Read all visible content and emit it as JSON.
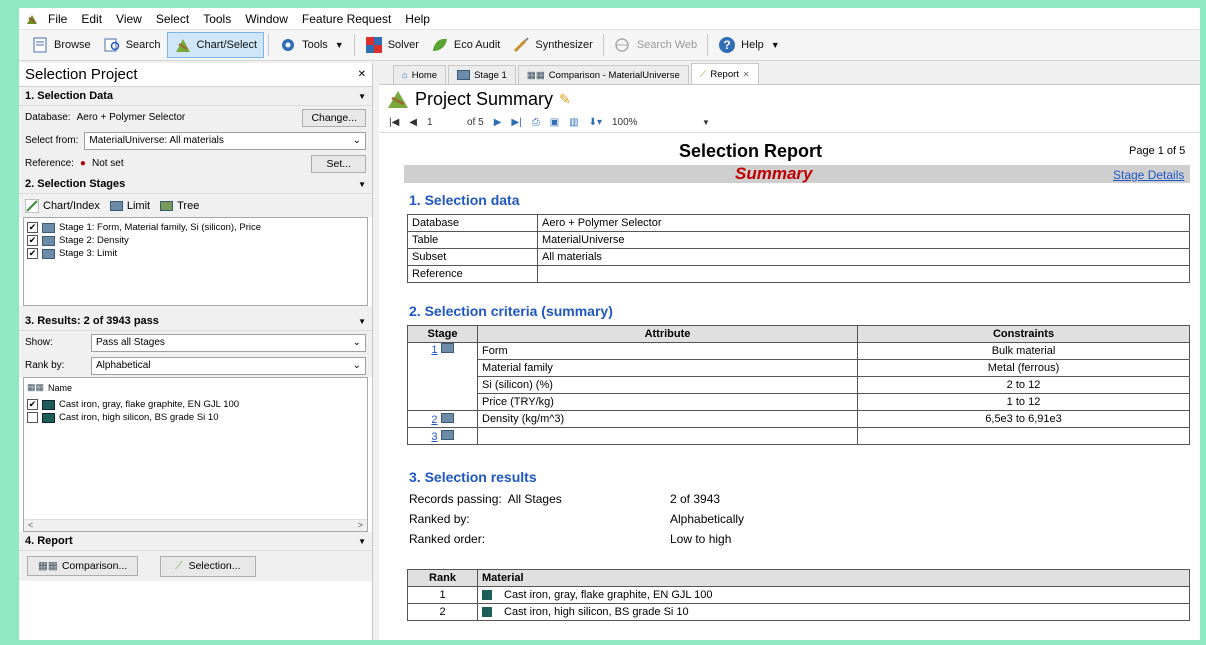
{
  "menu": {
    "items": [
      "File",
      "Edit",
      "View",
      "Select",
      "Tools",
      "Window",
      "Feature Request",
      "Help"
    ]
  },
  "toolbar": {
    "browse": "Browse",
    "search": "Search",
    "chart_select": "Chart/Select",
    "tools": "Tools",
    "solver": "Solver",
    "eco_audit": "Eco Audit",
    "synthesizer": "Synthesizer",
    "search_web": "Search Web",
    "help": "Help"
  },
  "left": {
    "title": "Selection Project",
    "sec1": "1. Selection Data",
    "database_label": "Database:",
    "database_value": "Aero + Polymer Selector",
    "change": "Change...",
    "select_from_label": "Select from:",
    "select_from_value": "MaterialUniverse: All materials",
    "reference_label": "Reference:",
    "reference_value": "Not set",
    "set": "Set...",
    "sec2": "2. Selection Stages",
    "stage_tools": [
      "Chart/Index",
      "Limit",
      "Tree"
    ],
    "stages": [
      "Stage 1: Form, Material family, Si (silicon), Price",
      "Stage 2: Density",
      "Stage 3: Limit"
    ],
    "sec3": "3. Results: 2 of 3943 pass",
    "show_label": "Show:",
    "show_value": "Pass all Stages",
    "rank_label": "Rank by:",
    "rank_value": "Alphabetical",
    "name_header": "Name",
    "results": [
      "Cast iron, gray, flake graphite, EN GJL 100",
      "Cast iron, high silicon, BS grade Si 10"
    ],
    "sec4": "4. Report",
    "comparison": "Comparison...",
    "selection": "Selection..."
  },
  "tabs": [
    "Home",
    "Stage 1",
    "Comparison - MaterialUniverse",
    "Report"
  ],
  "page_title": "Project Summary",
  "nav": {
    "page": "1",
    "of": "of 5",
    "zoom": "100%"
  },
  "report": {
    "title": "Selection Report",
    "page": "Page 1 of 5",
    "summary": "Summary",
    "stage_details": "Stage Details",
    "h1": "1. Selection data",
    "data_rows": [
      [
        "Database",
        "Aero + Polymer Selector"
      ],
      [
        "Table",
        "MaterialUniverse"
      ],
      [
        "Subset",
        "All materials"
      ],
      [
        "Reference",
        ""
      ]
    ],
    "h2": "2. Selection criteria (summary)",
    "crit_headers": [
      "Stage",
      "Attribute",
      "Constraints"
    ],
    "crit_rows": [
      [
        "1",
        "Form",
        "Bulk material"
      ],
      [
        "",
        "Material family",
        "Metal (ferrous)"
      ],
      [
        "",
        "Si (silicon) (%)",
        "2 to 12"
      ],
      [
        "",
        "Price (TRY/kg)",
        "1 to 12"
      ],
      [
        "2",
        "Density (kg/m^3)",
        "6,5e3 to 6,91e3"
      ],
      [
        "3",
        "",
        ""
      ]
    ],
    "h3": "3. Selection results",
    "res_labels": [
      "Records passing:  All Stages",
      "Ranked by:",
      "Ranked order:"
    ],
    "res_values": [
      "2 of 3943",
      "Alphabetically",
      "Low to high"
    ],
    "rank_headers": [
      "Rank",
      "Material"
    ],
    "rank_rows": [
      [
        "1",
        "Cast iron, gray, flake graphite, EN GJL 100"
      ],
      [
        "2",
        "Cast iron, high silicon, BS grade Si 10"
      ]
    ]
  },
  "colors": {
    "accent": "#1f57c3",
    "summary_red": "#c00000",
    "frame": "#8ee8c2"
  }
}
